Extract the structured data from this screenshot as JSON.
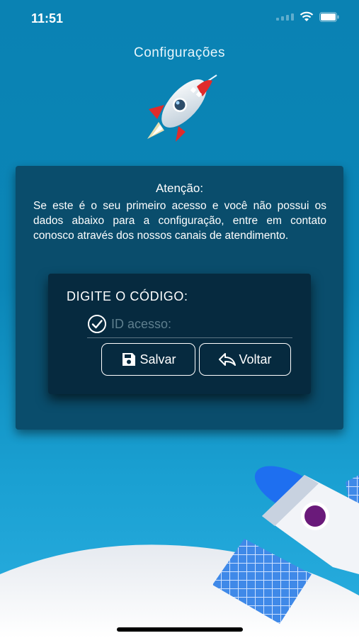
{
  "status_bar": {
    "time": "11:51"
  },
  "header": {
    "title": "Configurações"
  },
  "notice": {
    "title": "Atenção:",
    "text": "Se este é o seu primeiro acesso e você não possui os dados abaixo para a configuração, entre em contato conosco através dos nossos canais de atendimento."
  },
  "form": {
    "label": "DIGITE O CÓDIGO:",
    "id_field": {
      "value": "",
      "placeholder": "ID acesso:"
    },
    "save_label": "Salvar",
    "back_label": "Voltar"
  },
  "colors": {
    "background": "#0a82b3",
    "card": "#0a4d6c",
    "inner_card": "#062a3f",
    "accent_blue": "#1e6ff0",
    "accent_purple": "#6a1a7a"
  },
  "icons": [
    "wifi-icon",
    "battery-icon",
    "rocket-icon",
    "check-circle-icon",
    "save-icon",
    "back-arrow-icon"
  ]
}
